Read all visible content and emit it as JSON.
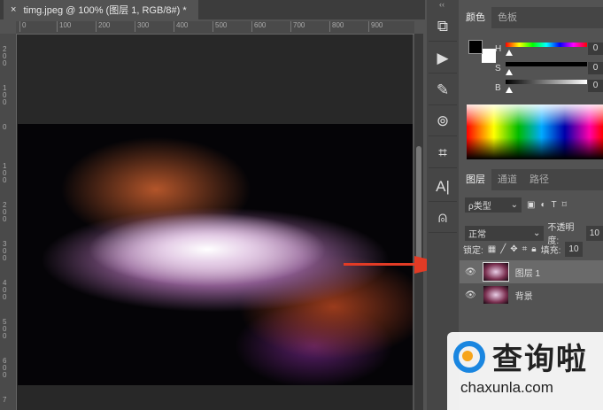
{
  "document": {
    "tab_title": "timg.jpeg @ 100% (图层 1, RGB/8#) *",
    "close_icon": "×"
  },
  "ruler_top": [
    "0",
    "100",
    "200",
    "300",
    "400",
    "500",
    "600",
    "700",
    "800",
    "900"
  ],
  "ruler_left": [
    "200",
    "100",
    "0",
    "100",
    "200",
    "300",
    "400",
    "500",
    "600",
    "7"
  ],
  "toolbar": {
    "collapse": "‹‹",
    "tools": [
      "puzzle-icon",
      "play-icon",
      "brush-presets-icon",
      "clone-source-icon",
      "crop-icon",
      "character-icon",
      "stamp-icon"
    ],
    "char_label": "A|"
  },
  "color_panel": {
    "tabs": [
      "颜色",
      "色板"
    ],
    "h_label": "H",
    "s_label": "S",
    "b_label": "B",
    "h_value": "0",
    "s_value": "0",
    "b_value": "0",
    "foreground": "#000000",
    "background": "#ffffff"
  },
  "layers_panel": {
    "tabs": [
      "图层",
      "通道",
      "路径"
    ],
    "filter": "ρ类型",
    "blend_mode": "正常",
    "opacity_label": "不透明度:",
    "opacity_value": "10",
    "lock_label": "锁定:",
    "fill_label": "填充:",
    "fill_value": "10",
    "layers": [
      {
        "name": "图层 1",
        "selected": true
      },
      {
        "name": "背景",
        "selected": false
      }
    ]
  },
  "watermark": {
    "title": "查询啦",
    "url": "chaxunla.com"
  },
  "colors": {
    "arrow": "#e23b25",
    "watermark_blue": "#1a86e0",
    "watermark_orange": "#f6a41b"
  }
}
